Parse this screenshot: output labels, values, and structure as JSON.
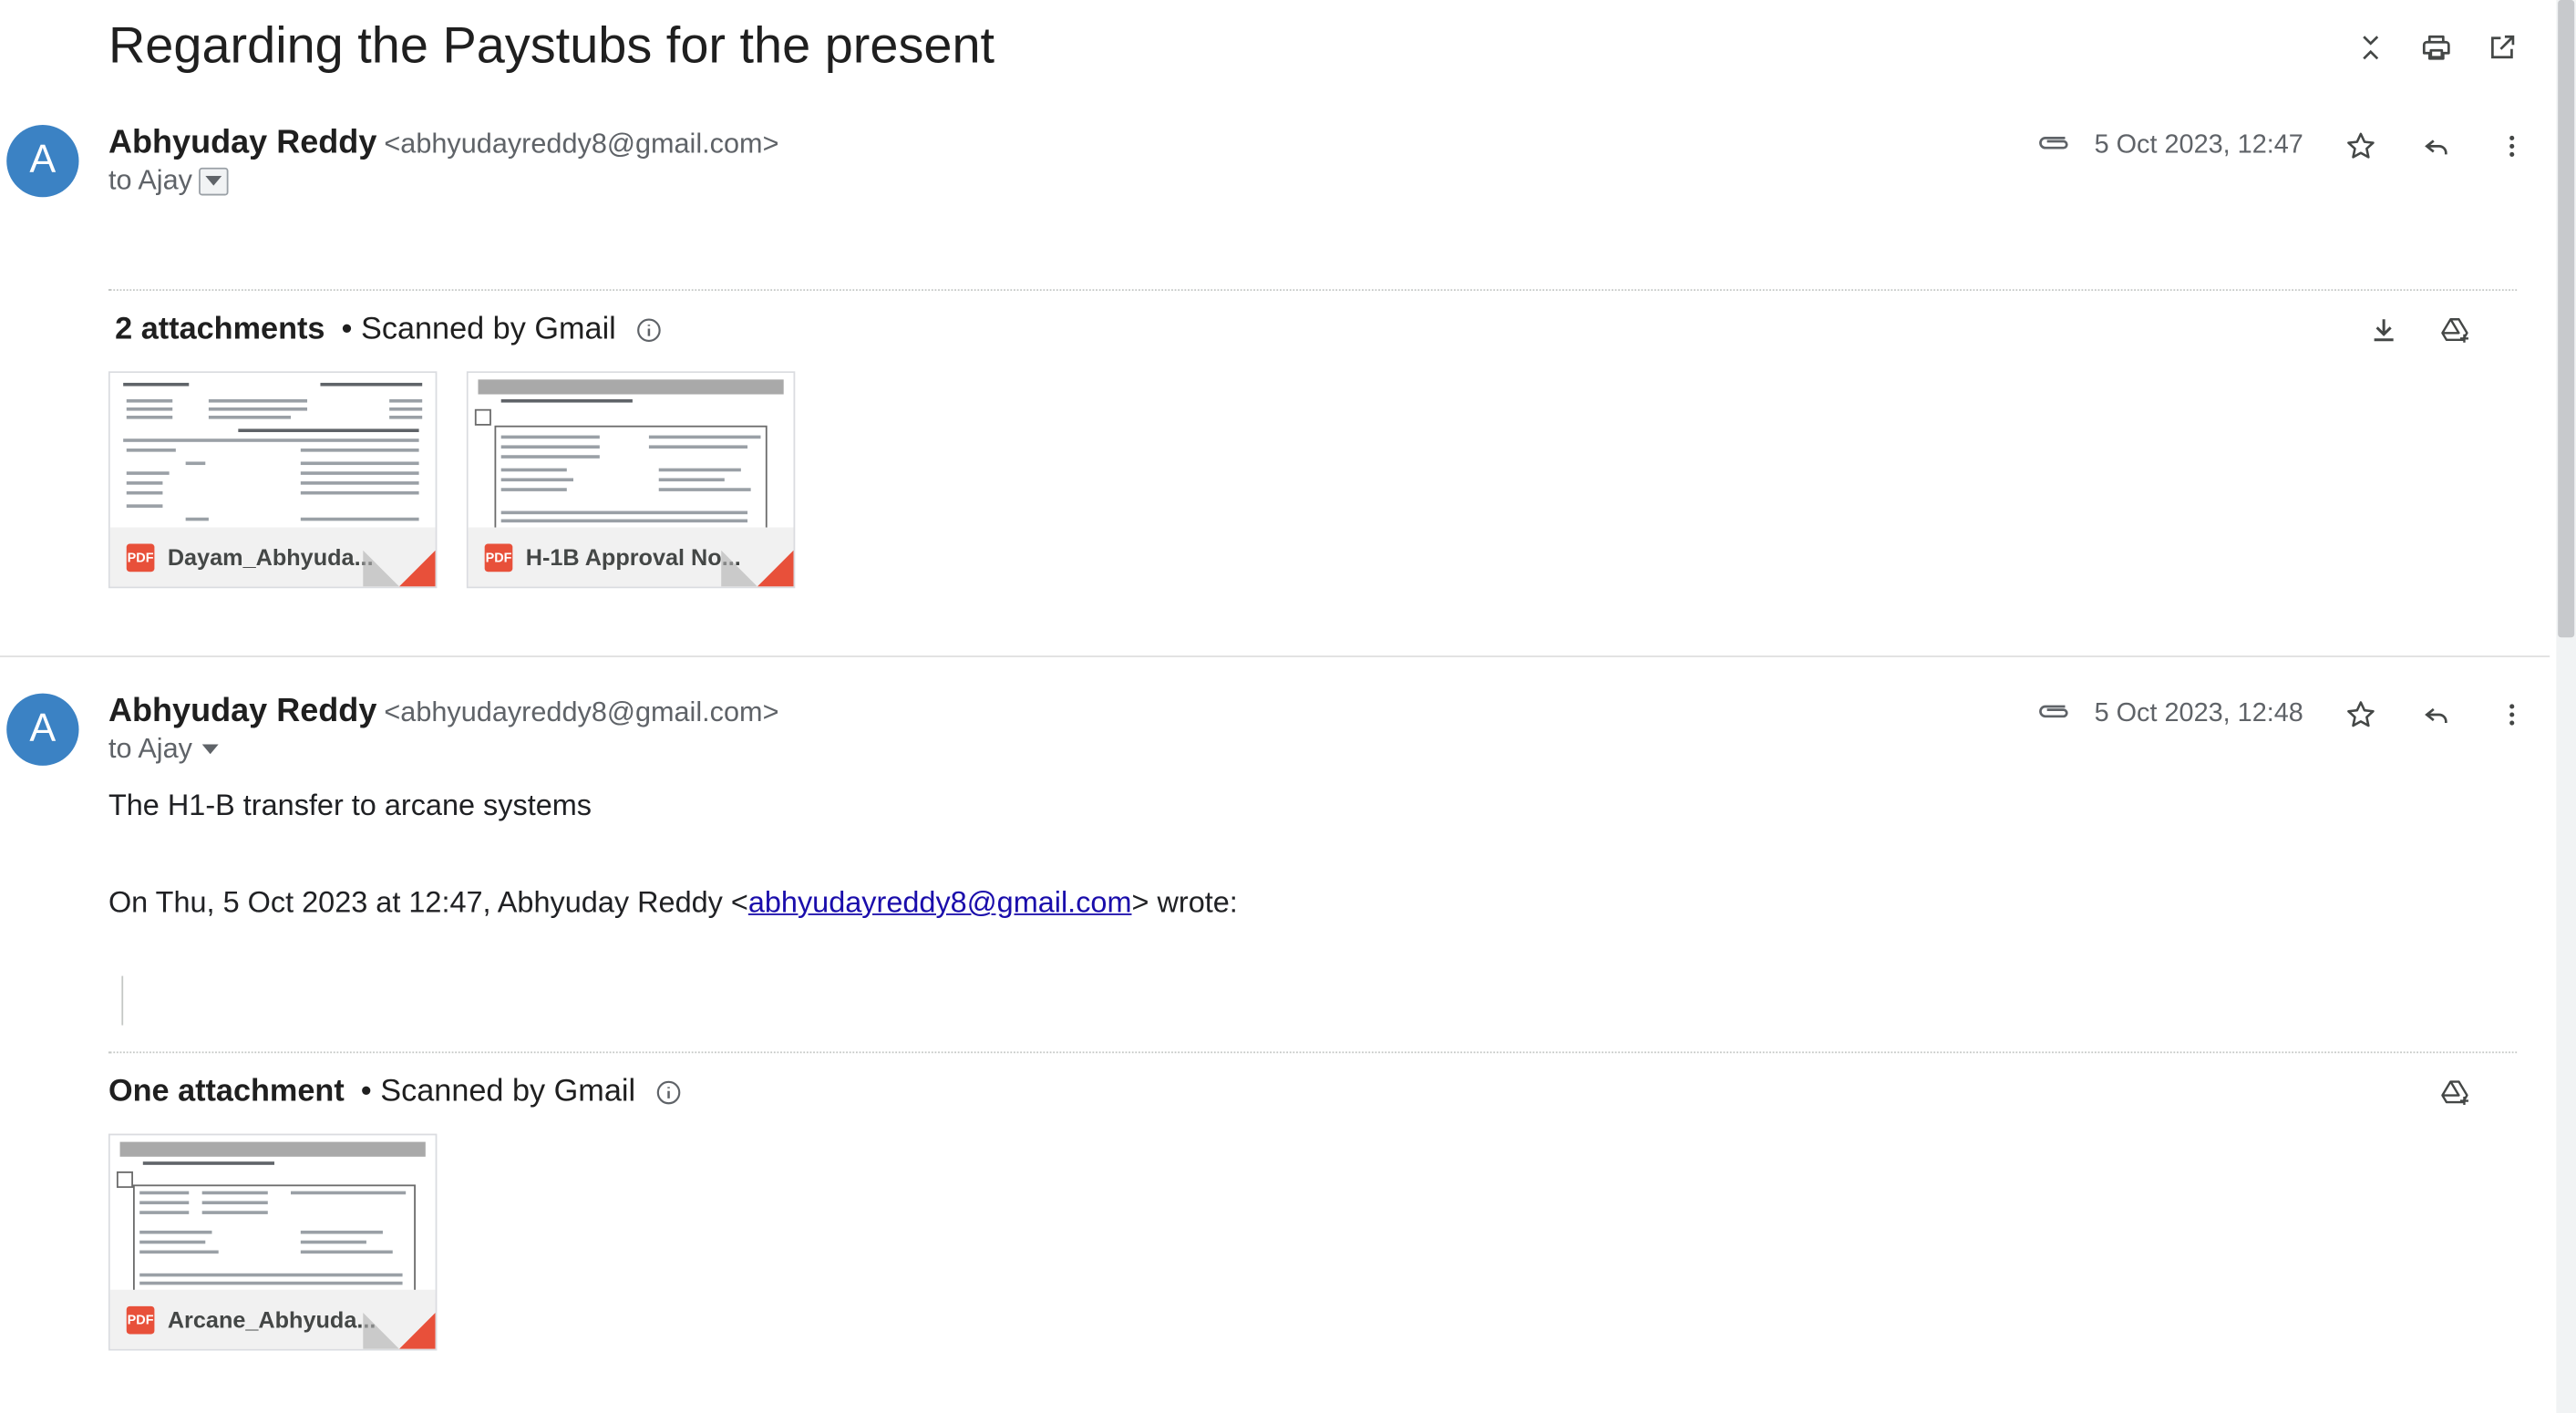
{
  "email": {
    "subject": "Regarding the Paystubs for the present"
  },
  "messages": [
    {
      "avatar_letter": "A",
      "sender_name": "Abhyuday Reddy",
      "sender_email": "<abhyudayreddy8@gmail.com>",
      "to": "to Ajay",
      "date": "5 Oct 2023, 12:47",
      "attachments_title": "2 attachments",
      "scanned": "• Scanned by Gmail",
      "attachments": [
        {
          "name": "Dayam_Abhyuda...",
          "badge": "PDF"
        },
        {
          "name": "H-1B Approval No...",
          "badge": "PDF"
        }
      ]
    },
    {
      "avatar_letter": "A",
      "sender_name": "Abhyuday Reddy",
      "sender_email": "<abhyudayreddy8@gmail.com>",
      "to": "to Ajay",
      "date": "5 Oct 2023, 12:48",
      "body": "The H1-B transfer to arcane systems",
      "quote_prefix": "On Thu, 5 Oct 2023 at 12:47, Abhyuday Reddy <",
      "quote_link": "abhyudayreddy8@gmail.com",
      "quote_suffix": "> wrote:",
      "attachments_title": "One attachment",
      "scanned": "• Scanned by Gmail",
      "attachments": [
        {
          "name": "Arcane_Abhyuda...",
          "badge": "PDF"
        }
      ]
    }
  ]
}
